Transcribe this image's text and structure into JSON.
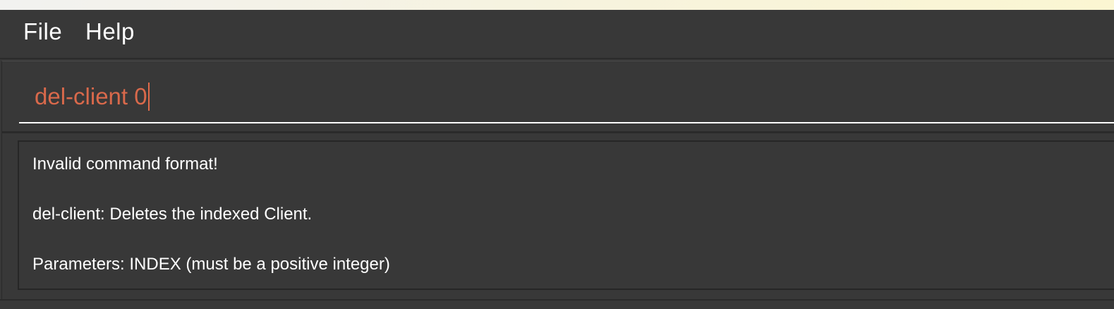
{
  "menubar": {
    "file_label": "File",
    "help_label": "Help"
  },
  "command_box": {
    "value": "del-client 0",
    "text_color": "#d9694b"
  },
  "result_display": {
    "lines": [
      "Invalid command format!",
      "del-client: Deletes the indexed Client.",
      "Parameters: INDEX (must be a positive integer)"
    ]
  },
  "colors": {
    "background": "#383838",
    "text": "#ffffff",
    "error_text": "#d9694b"
  }
}
